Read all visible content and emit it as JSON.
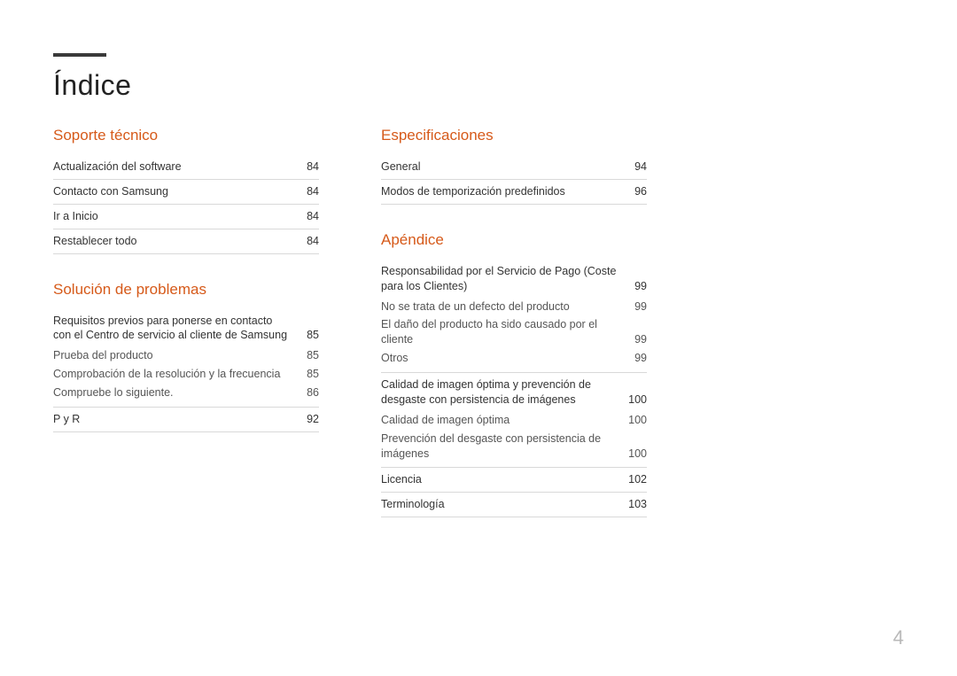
{
  "title": "Índice",
  "page_number": "4",
  "left_column": [
    {
      "heading": "Soporte técnico",
      "entries": [
        {
          "label": "Actualización del software",
          "page": "84",
          "type": "main"
        },
        {
          "label": "Contacto con Samsung",
          "page": "84",
          "type": "main"
        },
        {
          "label": "Ir a Inicio",
          "page": "84",
          "type": "main"
        },
        {
          "label": "Restablecer todo",
          "page": "84",
          "type": "main"
        }
      ]
    },
    {
      "heading": "Solución de problemas",
      "entries": [
        {
          "label": "Requisitos previos para ponerse en contacto con el Centro de servicio al cliente de Samsung",
          "page": "85",
          "type": "main"
        },
        {
          "label": "Prueba del producto",
          "page": "85",
          "type": "sub"
        },
        {
          "label": "Comprobación de la resolución y la frecuencia",
          "page": "85",
          "type": "sub"
        },
        {
          "label": "Compruebe lo siguiente.",
          "page": "86",
          "type": "sub"
        },
        {
          "label": "P y R",
          "page": "92",
          "type": "main"
        }
      ]
    }
  ],
  "right_column": [
    {
      "heading": "Especificaciones",
      "entries": [
        {
          "label": "General",
          "page": "94",
          "type": "main"
        },
        {
          "label": "Modos de temporización predefinidos",
          "page": "96",
          "type": "main"
        }
      ]
    },
    {
      "heading": "Apéndice",
      "entries": [
        {
          "label": "Responsabilidad por el Servicio de Pago (Coste para los Clientes)",
          "page": "99",
          "type": "main"
        },
        {
          "label": "No se trata de un defecto del producto",
          "page": "99",
          "type": "sub"
        },
        {
          "label": "El daño del producto ha sido causado por el cliente",
          "page": "99",
          "type": "sub"
        },
        {
          "label": "Otros",
          "page": "99",
          "type": "sub"
        },
        {
          "label": "Calidad de imagen óptima y prevención de desgaste con persistencia de imágenes",
          "page": "100",
          "type": "main"
        },
        {
          "label": "Calidad de imagen óptima",
          "page": "100",
          "type": "sub"
        },
        {
          "label": "Prevención del desgaste con persistencia de imágenes",
          "page": "100",
          "type": "sub"
        },
        {
          "label": "Licencia",
          "page": "102",
          "type": "main"
        },
        {
          "label": "Terminología",
          "page": "103",
          "type": "main"
        }
      ]
    }
  ]
}
